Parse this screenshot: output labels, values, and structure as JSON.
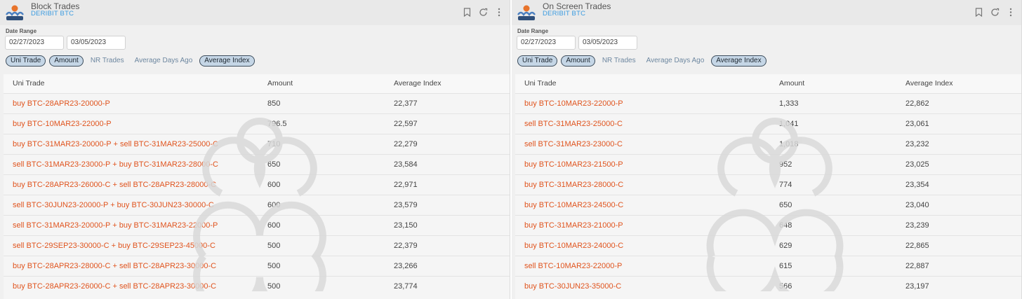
{
  "panels": [
    {
      "title": "Block Trades",
      "subtitle": "DERIBIT BTC",
      "date_range_label": "Date Range",
      "date_start": "02/27/2023",
      "date_end": "03/05/2023",
      "filters": [
        {
          "label": "Uni Trade",
          "active": true
        },
        {
          "label": "Amount",
          "active": true
        },
        {
          "label": "NR Trades",
          "active": false
        },
        {
          "label": "Average Days Ago",
          "active": false
        },
        {
          "label": "Average Index",
          "active": true
        }
      ],
      "columns": [
        "Uni Trade",
        "Amount",
        "Average Index"
      ],
      "rows": [
        {
          "trade": "buy BTC-28APR23-20000-P",
          "amount": "850",
          "avg_index": "22,377"
        },
        {
          "trade": "buy BTC-10MAR23-22000-P",
          "amount": "796.5",
          "avg_index": "22,597"
        },
        {
          "trade": "buy BTC-31MAR23-20000-P + sell BTC-31MAR23-25000-C",
          "amount": "710",
          "avg_index": "22,279"
        },
        {
          "trade": "sell BTC-31MAR23-23000-P + buy BTC-31MAR23-28000-C",
          "amount": "650",
          "avg_index": "23,584"
        },
        {
          "trade": "buy BTC-28APR23-26000-C + sell BTC-28APR23-28000-C",
          "amount": "600",
          "avg_index": "22,971"
        },
        {
          "trade": "sell BTC-30JUN23-20000-P + buy BTC-30JUN23-30000-C",
          "amount": "600",
          "avg_index": "23,579"
        },
        {
          "trade": "sell BTC-31MAR23-20000-P + buy BTC-31MAR23-22000-P",
          "amount": "600",
          "avg_index": "23,150"
        },
        {
          "trade": "sell BTC-29SEP23-30000-C + buy BTC-29SEP23-45000-C",
          "amount": "500",
          "avg_index": "22,379"
        },
        {
          "trade": "buy BTC-28APR23-28000-C + sell BTC-28APR23-30000-C",
          "amount": "500",
          "avg_index": "23,266"
        },
        {
          "trade": "buy BTC-28APR23-26000-C + sell BTC-28APR23-30000-C",
          "amount": "500",
          "avg_index": "23,774"
        }
      ]
    },
    {
      "title": "On Screen Trades",
      "subtitle": "DERIBIT BTC",
      "date_range_label": "Date Range",
      "date_start": "02/27/2023",
      "date_end": "03/05/2023",
      "filters": [
        {
          "label": "Uni Trade",
          "active": true
        },
        {
          "label": "Amount",
          "active": true
        },
        {
          "label": "NR Trades",
          "active": false
        },
        {
          "label": "Average Days Ago",
          "active": false
        },
        {
          "label": "Average Index",
          "active": true
        }
      ],
      "columns": [
        "Uni Trade",
        "Amount",
        "Average Index"
      ],
      "rows": [
        {
          "trade": "buy BTC-10MAR23-22000-P",
          "amount": "1,333",
          "avg_index": "22,862"
        },
        {
          "trade": "sell BTC-31MAR23-25000-C",
          "amount": "1,041",
          "avg_index": "23,061"
        },
        {
          "trade": "sell BTC-31MAR23-23000-C",
          "amount": "1,018",
          "avg_index": "23,232"
        },
        {
          "trade": "buy BTC-10MAR23-21500-P",
          "amount": "952",
          "avg_index": "23,025"
        },
        {
          "trade": "buy BTC-31MAR23-28000-C",
          "amount": "774",
          "avg_index": "23,354"
        },
        {
          "trade": "buy BTC-10MAR23-24500-C",
          "amount": "650",
          "avg_index": "23,040"
        },
        {
          "trade": "buy BTC-31MAR23-21000-P",
          "amount": "648",
          "avg_index": "23,239"
        },
        {
          "trade": "buy BTC-10MAR23-24000-C",
          "amount": "629",
          "avg_index": "22,865"
        },
        {
          "trade": "sell BTC-10MAR23-22000-P",
          "amount": "615",
          "avg_index": "22,887"
        },
        {
          "trade": "buy BTC-30JUN23-35000-C",
          "amount": "566",
          "avg_index": "23,197"
        }
      ]
    }
  ],
  "icons": [
    "bookmark-icon",
    "refresh-icon",
    "more-vertical-icon"
  ],
  "colors": {
    "trade_text": "#e0541e",
    "subtitle": "#3a9be0",
    "chip_active_bg": "#c5d6e6",
    "chip_inactive_text": "#6d87a0"
  }
}
